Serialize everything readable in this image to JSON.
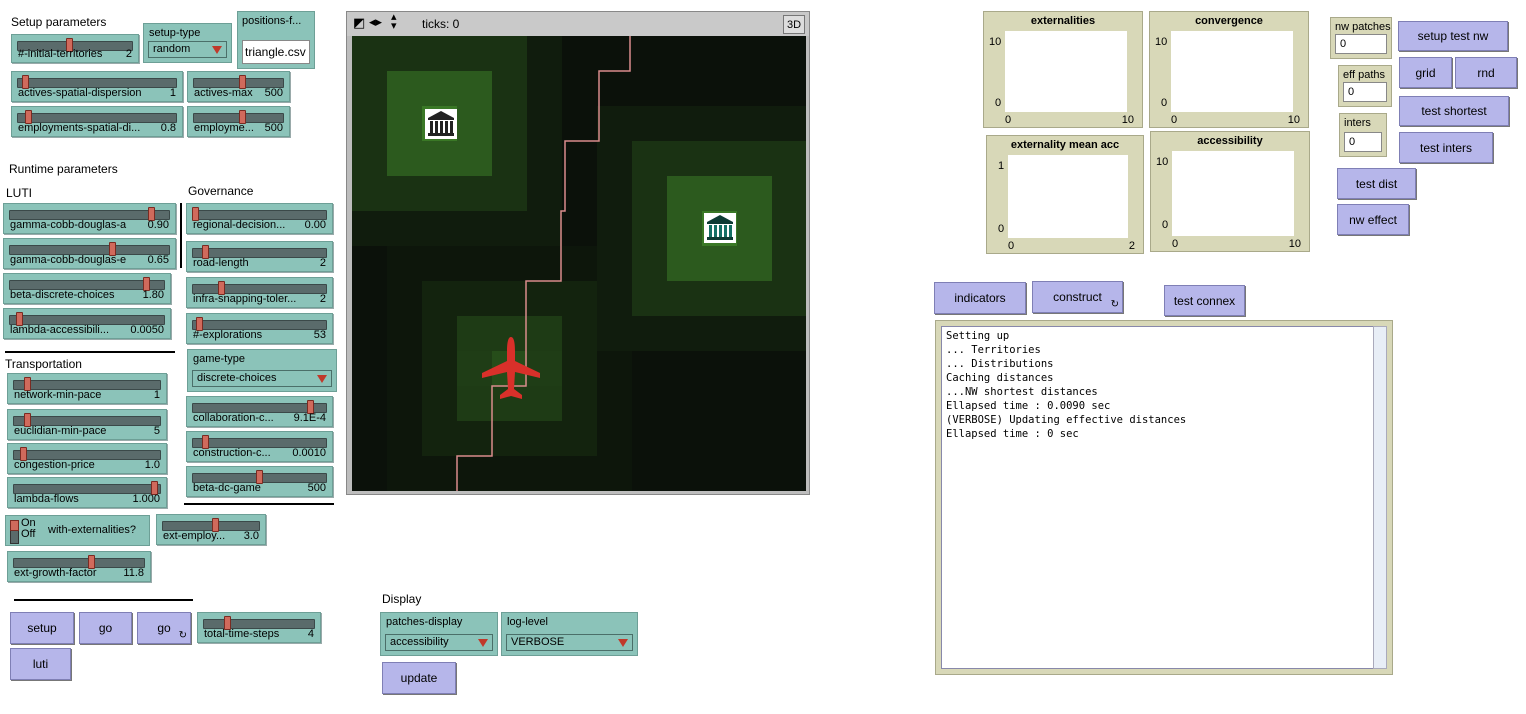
{
  "sections": {
    "setup": "Setup parameters",
    "runtime": "Runtime parameters",
    "luti": "LUTI",
    "governance": "Governance",
    "transportation": "Transportation",
    "display": "Display"
  },
  "setup_sliders": [
    {
      "name": "#-initial-territories",
      "value": "2",
      "pos": 0.45
    },
    {
      "name": "actives-spatial-dispersion",
      "value": "1",
      "pos": 0.03
    },
    {
      "name": "actives-max",
      "value": "500",
      "pos": 0.55
    },
    {
      "name": "employments-spatial-di...",
      "value": "0.8",
      "pos": 0.05
    },
    {
      "name": "employme...",
      "value": "500",
      "pos": 0.55
    }
  ],
  "setup_type": {
    "label": "setup-type",
    "value": "random"
  },
  "positions_file": {
    "label": "positions-f...",
    "value": "triangle.csv"
  },
  "luti_sliders": [
    {
      "name": "gamma-cobb-douglas-a",
      "value": "0.90",
      "pos": 0.9
    },
    {
      "name": "gamma-cobb-douglas-e",
      "value": "0.65",
      "pos": 0.65
    },
    {
      "name": "beta-discrete-choices",
      "value": "1.80",
      "pos": 0.9
    },
    {
      "name": "lambda-accessibili...",
      "value": "0.0050",
      "pos": 0.05
    }
  ],
  "governance_sliders": [
    {
      "name": "regional-decision...",
      "value": "0.00",
      "pos": 0.0
    },
    {
      "name": "road-length",
      "value": "2",
      "pos": 0.08
    },
    {
      "name": "infra-snapping-toler...",
      "value": "2",
      "pos": 0.2
    },
    {
      "name": "#-explorations",
      "value": "53",
      "pos": 0.03
    }
  ],
  "game_type": {
    "label": "game-type",
    "value": "discrete-choices"
  },
  "governance_sliders2": [
    {
      "name": "collaboration-c...",
      "value": "9.1E-4",
      "pos": 0.9
    },
    {
      "name": "construction-c...",
      "value": "0.0010",
      "pos": 0.08
    },
    {
      "name": "beta-dc-game",
      "value": "500",
      "pos": 0.5
    }
  ],
  "transport_sliders": [
    {
      "name": "network-min-pace",
      "value": "1",
      "pos": 0.08
    },
    {
      "name": "euclidian-min-pace",
      "value": "5",
      "pos": 0.08
    },
    {
      "name": "congestion-price",
      "value": "1.0",
      "pos": 0.05
    },
    {
      "name": "lambda-flows",
      "value": "1.000",
      "pos": 0.98
    }
  ],
  "switch": {
    "on": "On",
    "off": "Off",
    "name": "with-externalities?"
  },
  "ext_sliders": [
    {
      "name": "ext-employ...",
      "value": "3.0",
      "pos": 0.55
    },
    {
      "name": "ext-growth-factor",
      "value": "11.8",
      "pos": 0.6
    }
  ],
  "run_buttons": {
    "setup": "setup",
    "go": "go",
    "go_forever": "go",
    "luti": "luti"
  },
  "total_time_steps": {
    "name": "total-time-steps",
    "value": "4",
    "pos": 0.2
  },
  "patches_display": {
    "label": "patches-display",
    "value": "accessibility"
  },
  "log_level": {
    "label": "log-level",
    "value": "VERBOSE"
  },
  "update_button": "update",
  "view": {
    "ticks": "ticks: 0",
    "three_d": "3D"
  },
  "plots": [
    {
      "title": "externalities",
      "ymax": "10",
      "ymin": "0",
      "xmin": "0",
      "xmax": "10"
    },
    {
      "title": "convergence",
      "ymax": "10",
      "ymin": "0",
      "xmin": "0",
      "xmax": "10"
    },
    {
      "title": "externality mean acc",
      "ymax": "1",
      "ymin": "0",
      "xmin": "0",
      "xmax": "2"
    },
    {
      "title": "accessibility",
      "ymax": "10",
      "ymin": "0",
      "xmin": "0",
      "xmax": "10"
    }
  ],
  "inputs": {
    "nw_patches": {
      "label": "nw patches",
      "value": "0"
    },
    "eff_paths": {
      "label": "eff paths",
      "value": "0"
    },
    "inters": {
      "label": "inters",
      "value": "0"
    }
  },
  "tests": {
    "setup_test_nw": "setup test nw",
    "grid": "grid",
    "rnd": "rnd",
    "test_shortest": "test shortest",
    "test_inters": "test inters",
    "test_dist": "test dist",
    "nw_effect": "nw effect"
  },
  "indicators": "indicators",
  "construct": "construct",
  "test_connex": "test connex",
  "output": "Setting up\n... Territories\n... Distributions\nCaching distances\n...NW shortest distances\nEllapsed time : 0.0090 sec\n(VERBOSE) Updating effective distances\nEllapsed time : 0 sec",
  "colors": {
    "slider": "#8bc3b9",
    "button": "#b6b6ea",
    "panel": "#d8d8b8",
    "handle": "#d06a5c"
  }
}
